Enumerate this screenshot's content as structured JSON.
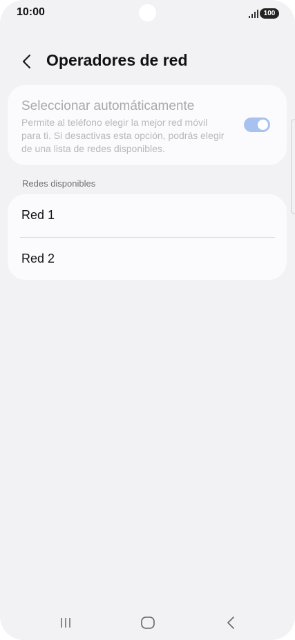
{
  "status_bar": {
    "time": "10:00",
    "battery": "100"
  },
  "header": {
    "title": "Operadores de red"
  },
  "auto_select": {
    "title": "Seleccionar automáticamente",
    "description": "Permite al teléfono elegir la mejor red móvil para ti. Si desactivas esta opción, podrás elegir de una lista de redes disponibles.",
    "enabled": true
  },
  "networks": {
    "section_label": "Redes disponibles",
    "items": [
      {
        "label": "Red 1"
      },
      {
        "label": "Red 2"
      }
    ]
  },
  "colors": {
    "background": "#f2f2f5",
    "card": "#fbfbfd",
    "toggle_on_disabled": "#a7c2ef"
  },
  "icons": {
    "back": "chevron-left-icon",
    "recents": "recents-icon",
    "home": "home-icon",
    "nav_back": "back-icon"
  }
}
